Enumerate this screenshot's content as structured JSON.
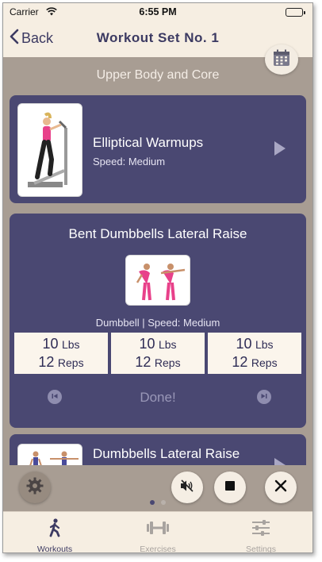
{
  "status": {
    "carrier": "Carrier",
    "time": "6:55 PM"
  },
  "nav": {
    "back_label": "Back",
    "title": "Workout Set No. 1"
  },
  "section": {
    "title": "Upper Body and Core"
  },
  "exercises": [
    {
      "name": "Elliptical Warmups",
      "detail": "Speed: Medium"
    },
    {
      "name": "Bent Dumbbells Lateral Raise",
      "detail": "Dumbbell | Speed: Medium",
      "sets": [
        {
          "weight": "10",
          "weight_unit": "Lbs",
          "reps": "12",
          "reps_unit": "Reps"
        },
        {
          "weight": "10",
          "weight_unit": "Lbs",
          "reps": "12",
          "reps_unit": "Reps"
        },
        {
          "weight": "10",
          "weight_unit": "Lbs",
          "reps": "12",
          "reps_unit": "Reps"
        }
      ],
      "done_label": "Done!"
    },
    {
      "name": "Dumbbells Lateral Raise"
    }
  ],
  "tabs": [
    {
      "label": "Workouts",
      "icon": "person-walking-icon",
      "active": true
    },
    {
      "label": "Exercises",
      "icon": "dumbbell-icon",
      "active": false
    },
    {
      "label": "Settings",
      "icon": "sliders-icon",
      "active": false
    }
  ],
  "pager": {
    "pages": 2,
    "current": 1
  },
  "colors": {
    "accent": "#4a4872",
    "background": "#a89d93",
    "bar": "#f6eee2",
    "card_text": "#ffffff"
  }
}
